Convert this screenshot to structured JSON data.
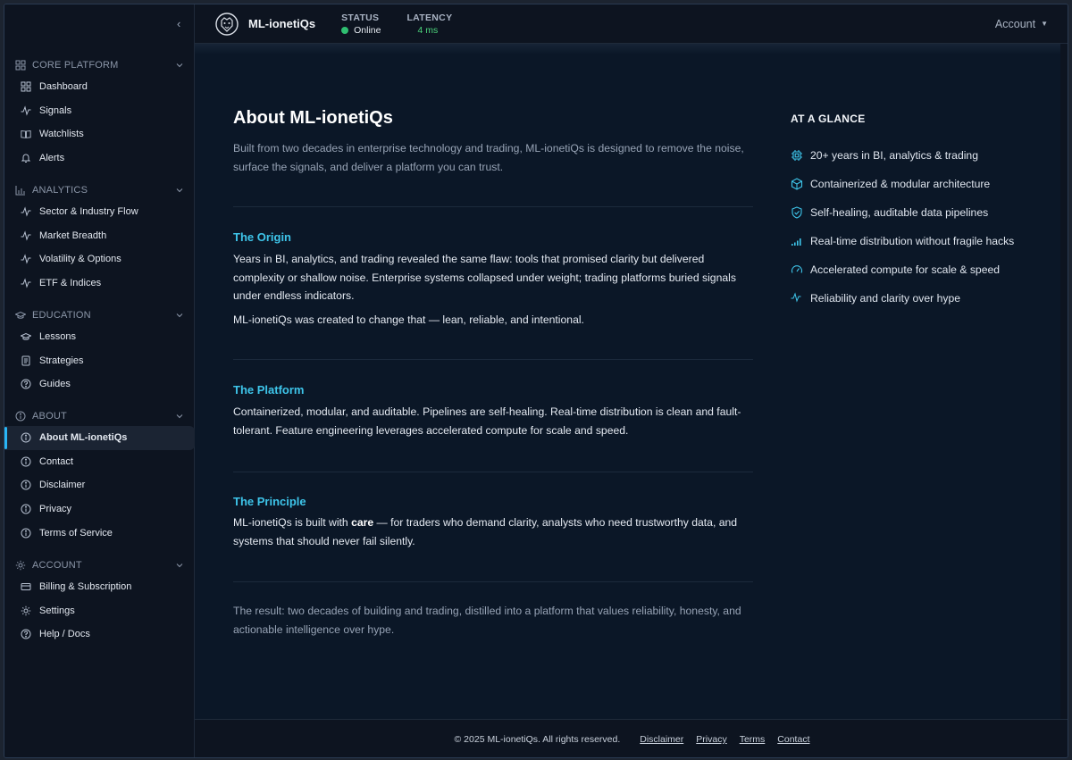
{
  "header": {
    "brand": "ML-ionetiQs",
    "status_label": "STATUS",
    "status_value": "Online",
    "latency_label": "LATENCY",
    "latency_value": "4 ms",
    "account": "Account",
    "status_color": "#2fbf71"
  },
  "sidebar": {
    "collapse": "‹",
    "sections": [
      {
        "title": "CORE PLATFORM",
        "icon": "grid-icon",
        "items": [
          {
            "label": "Dashboard",
            "icon": "grid-icon"
          },
          {
            "label": "Signals",
            "icon": "pulse-icon"
          },
          {
            "label": "Watchlists",
            "icon": "book-icon"
          },
          {
            "label": "Alerts",
            "icon": "bell-icon"
          }
        ]
      },
      {
        "title": "ANALYTICS",
        "icon": "bar-chart-icon",
        "items": [
          {
            "label": "Sector & Industry Flow",
            "icon": "pulse-icon"
          },
          {
            "label": "Market Breadth",
            "icon": "pulse-icon"
          },
          {
            "label": "Volatility & Options",
            "icon": "pulse-icon"
          },
          {
            "label": "ETF & Indices",
            "icon": "pulse-icon"
          }
        ]
      },
      {
        "title": "EDUCATION",
        "icon": "mortarboard-icon",
        "items": [
          {
            "label": "Lessons",
            "icon": "mortarboard-icon"
          },
          {
            "label": "Strategies",
            "icon": "journal-icon"
          },
          {
            "label": "Guides",
            "icon": "question-icon"
          }
        ]
      },
      {
        "title": "ABOUT",
        "icon": "info-icon",
        "items": [
          {
            "label": "About ML-ionetiQs",
            "icon": "info-icon",
            "active": true
          },
          {
            "label": "Contact",
            "icon": "info-icon"
          },
          {
            "label": "Disclaimer",
            "icon": "info-icon"
          },
          {
            "label": "Privacy",
            "icon": "info-icon"
          },
          {
            "label": "Terms of Service",
            "icon": "info-icon"
          }
        ]
      },
      {
        "title": "ACCOUNT",
        "icon": "gear-icon",
        "items": [
          {
            "label": "Billing & Subscription",
            "icon": "card-icon"
          },
          {
            "label": "Settings",
            "icon": "gear-icon"
          },
          {
            "label": "Help / Docs",
            "icon": "question-icon"
          }
        ]
      }
    ]
  },
  "main": {
    "title": "About ML-ionetiQs",
    "intro": "Built from two decades in enterprise technology and trading, ML-ionetiQs is designed to remove the noise, surface the signals, and deliver a platform you can trust.",
    "origin": {
      "title": "The Origin",
      "p1": "Years in BI, analytics, and trading revealed the same flaw: tools that promised clarity but delivered complexity or shallow noise. Enterprise systems collapsed under weight; trading platforms buried signals under endless indicators.",
      "p2": "ML-ionetiQs was created to change that — lean, reliable, and intentional."
    },
    "platform": {
      "title": "The Platform",
      "p1": "Containerized, modular, and auditable. Pipelines are self-healing. Real-time distribution is clean and fault-tolerant. Feature engineering leverages accelerated compute for scale and speed."
    },
    "principle": {
      "title": "The Principle",
      "p1_before": "ML-ionetiQs is built with ",
      "p1_bold": "care",
      "p1_after": " — for traders who demand clarity, analysts who need trustworthy data, and systems that should never fail silently."
    },
    "result": "The result: two decades of building and trading, distilled into a platform that values reliability, honesty, and actionable intelligence over hype."
  },
  "glance": {
    "title": "AT A GLANCE",
    "items": [
      {
        "label": "20+ years in BI, analytics & trading",
        "icon": "cpu-icon"
      },
      {
        "label": "Containerized & modular architecture",
        "icon": "box-icon"
      },
      {
        "label": "Self-healing, auditable data pipelines",
        "icon": "shield-icon"
      },
      {
        "label": "Real-time distribution without fragile hacks",
        "icon": "signal-bars-icon"
      },
      {
        "label": "Accelerated compute for scale & speed",
        "icon": "speedometer-icon"
      },
      {
        "label": "Reliability and clarity over hype",
        "icon": "pulse-icon"
      }
    ],
    "accent": "#3ec5ea"
  },
  "footer": {
    "copyright": "© 2025 ML-ionetiQs. All rights reserved.",
    "links": [
      "Disclaimer",
      "Privacy",
      "Terms",
      "Contact"
    ]
  }
}
